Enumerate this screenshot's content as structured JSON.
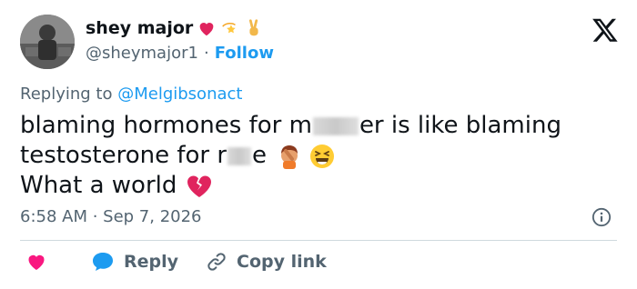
{
  "author": {
    "name": "shey major",
    "handle": "@sheymajor1",
    "separator": "·",
    "follow_label": "Follow",
    "name_emojis": [
      "red-heart-icon",
      "dizzy-star-icon",
      "victory-hand-icon"
    ]
  },
  "replying": {
    "prefix": "Replying to",
    "mention": "@Melgibsonact"
  },
  "tweet": {
    "line1_a": "blaming hormones for m",
    "line1_b": "er is like blaming",
    "line2_a": "testosterone for r",
    "line2_b": "e",
    "line3": "What a world"
  },
  "meta": {
    "timestamp": "6:58 AM · Sep 7, 2026"
  },
  "actions": {
    "reply_label": "Reply",
    "copy_label": "Copy link"
  },
  "colors": {
    "accent": "#1d9bf0",
    "heart": "#f91880",
    "secondary_text": "#536471"
  }
}
